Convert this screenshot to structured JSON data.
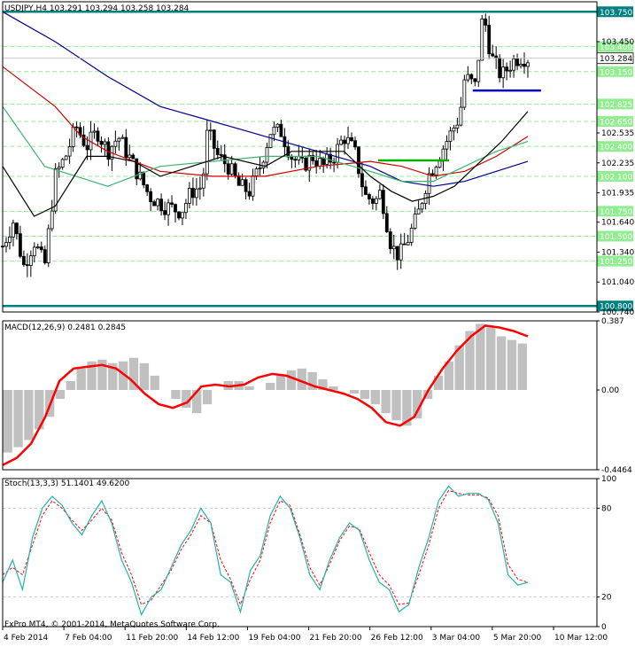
{
  "chart_data": {
    "type": "candlestick",
    "symbol_header": "USDJPY,H4  103.291 103.294 103.258 103.284",
    "current_price": {
      "value": 103.284,
      "label": "103.284"
    },
    "price_axis": {
      "ylim": [
        100.74,
        103.85
      ],
      "ticks": [
        {
          "v": 103.45,
          "t": "103.450"
        },
        {
          "v": 102.535,
          "t": "102.535"
        },
        {
          "v": 102.235,
          "t": "102.235"
        },
        {
          "v": 101.935,
          "t": "101.935"
        },
        {
          "v": 101.64,
          "t": "101.640"
        },
        {
          "v": 101.34,
          "t": "101.340"
        },
        {
          "v": 101.04,
          "t": "101.040"
        },
        {
          "v": 100.74,
          "t": "100.740"
        }
      ]
    },
    "horizontal_levels": [
      {
        "v": 103.75,
        "t": "103.750",
        "color": "#008080",
        "style": "solid"
      },
      {
        "v": 103.4,
        "t": "103.400",
        "color": "#90ee90",
        "style": "dash"
      },
      {
        "v": 103.15,
        "t": "103.150",
        "color": "#90ee90",
        "style": "dash"
      },
      {
        "v": 102.825,
        "t": "102.825",
        "color": "#90ee90",
        "style": "dash"
      },
      {
        "v": 102.65,
        "t": "102.650",
        "color": "#90ee90",
        "style": "dash"
      },
      {
        "v": 102.4,
        "t": "102.400",
        "color": "#90ee90",
        "style": "dash"
      },
      {
        "v": 102.1,
        "t": "102.100",
        "color": "#90ee90",
        "style": "dash"
      },
      {
        "v": 101.75,
        "t": "101.750",
        "color": "#90ee90",
        "style": "dash"
      },
      {
        "v": 101.5,
        "t": "101.500",
        "color": "#90ee90",
        "style": "dash"
      },
      {
        "v": 101.25,
        "t": "101.250",
        "color": "#90ee90",
        "style": "dash"
      },
      {
        "v": 100.8,
        "t": "100.800",
        "color": "#008080",
        "style": "solid"
      }
    ],
    "segments": [
      {
        "name": "green-support",
        "x0": 0.715,
        "x1": 0.85,
        "v": 102.26,
        "color": "#00b000"
      },
      {
        "name": "blue-support",
        "x0": 0.895,
        "x1": 1.025,
        "v": 102.96,
        "color": "#0000cc"
      }
    ],
    "candle_path": [
      [
        0,
        101.4
      ],
      [
        0.02,
        101.65
      ],
      [
        0.04,
        101.2
      ],
      [
        0.06,
        101.45
      ],
      [
        0.08,
        101.2
      ],
      [
        0.1,
        102.1
      ],
      [
        0.12,
        102.3
      ],
      [
        0.14,
        102.6
      ],
      [
        0.16,
        102.4
      ],
      [
        0.18,
        102.55
      ],
      [
        0.2,
        102.35
      ],
      [
        0.22,
        102.5
      ],
      [
        0.24,
        102.3
      ],
      [
        0.28,
        101.9
      ],
      [
        0.31,
        101.8
      ],
      [
        0.34,
        101.75
      ],
      [
        0.36,
        101.95
      ],
      [
        0.38,
        102.0
      ],
      [
        0.39,
        102.55
      ],
      [
        0.41,
        102.3
      ],
      [
        0.43,
        102.2
      ],
      [
        0.45,
        102.0
      ],
      [
        0.47,
        101.95
      ],
      [
        0.49,
        102.2
      ],
      [
        0.51,
        102.55
      ],
      [
        0.53,
        102.55
      ],
      [
        0.55,
        102.3
      ],
      [
        0.57,
        102.2
      ],
      [
        0.59,
        102.3
      ],
      [
        0.61,
        102.2
      ],
      [
        0.63,
        102.3
      ],
      [
        0.65,
        102.5
      ],
      [
        0.67,
        102.35
      ],
      [
        0.69,
        101.9
      ],
      [
        0.71,
        101.85
      ],
      [
        0.72,
        101.95
      ],
      [
        0.74,
        101.4
      ],
      [
        0.755,
        101.3
      ],
      [
        0.77,
        101.45
      ],
      [
        0.79,
        101.7
      ],
      [
        0.81,
        102.1
      ],
      [
        0.83,
        102.3
      ],
      [
        0.85,
        102.5
      ],
      [
        0.87,
        102.7
      ],
      [
        0.88,
        103.1
      ],
      [
        0.9,
        103.0
      ],
      [
        0.915,
        103.75
      ],
      [
        0.93,
        103.3
      ],
      [
        0.95,
        103.1
      ],
      [
        0.97,
        103.25
      ],
      [
        0.985,
        103.3
      ],
      [
        1.0,
        103.284
      ]
    ],
    "moving_averages": [
      {
        "color": "#00008b",
        "points": [
          [
            0,
            103.75
          ],
          [
            0.1,
            103.45
          ],
          [
            0.2,
            103.1
          ],
          [
            0.3,
            102.8
          ],
          [
            0.4,
            102.65
          ],
          [
            0.5,
            102.5
          ],
          [
            0.6,
            102.35
          ],
          [
            0.7,
            102.2
          ],
          [
            0.76,
            102.05
          ],
          [
            0.82,
            102.0
          ],
          [
            0.88,
            102.05
          ],
          [
            0.94,
            102.15
          ],
          [
            1.0,
            102.25
          ]
        ]
      },
      {
        "color": "#cc0000",
        "points": [
          [
            0,
            103.2
          ],
          [
            0.1,
            102.8
          ],
          [
            0.15,
            102.5
          ],
          [
            0.2,
            102.35
          ],
          [
            0.3,
            102.15
          ],
          [
            0.4,
            102.1
          ],
          [
            0.5,
            102.1
          ],
          [
            0.6,
            102.2
          ],
          [
            0.7,
            102.25
          ],
          [
            0.76,
            102.2
          ],
          [
            0.82,
            102.1
          ],
          [
            0.88,
            102.15
          ],
          [
            0.94,
            102.3
          ],
          [
            1.0,
            102.5
          ]
        ]
      },
      {
        "color": "#3cb371",
        "points": [
          [
            0,
            102.8
          ],
          [
            0.08,
            102.2
          ],
          [
            0.14,
            102.1
          ],
          [
            0.2,
            102.0
          ],
          [
            0.25,
            102.1
          ],
          [
            0.3,
            102.2
          ],
          [
            0.4,
            102.25
          ],
          [
            0.5,
            102.3
          ],
          [
            0.6,
            102.3
          ],
          [
            0.7,
            102.15
          ],
          [
            0.76,
            102.05
          ],
          [
            0.82,
            102.05
          ],
          [
            0.88,
            102.2
          ],
          [
            0.94,
            102.35
          ],
          [
            1.0,
            102.45
          ]
        ]
      },
      {
        "color": "#000000",
        "points": [
          [
            0,
            102.2
          ],
          [
            0.06,
            101.7
          ],
          [
            0.1,
            101.8
          ],
          [
            0.16,
            102.3
          ],
          [
            0.2,
            102.3
          ],
          [
            0.25,
            102.25
          ],
          [
            0.3,
            102.1
          ],
          [
            0.36,
            102.2
          ],
          [
            0.42,
            102.3
          ],
          [
            0.5,
            102.2
          ],
          [
            0.55,
            102.35
          ],
          [
            0.6,
            102.35
          ],
          [
            0.65,
            102.35
          ],
          [
            0.7,
            102.1
          ],
          [
            0.74,
            101.95
          ],
          [
            0.78,
            101.85
          ],
          [
            0.82,
            101.9
          ],
          [
            0.86,
            102.0
          ],
          [
            0.9,
            102.2
          ],
          [
            0.95,
            102.45
          ],
          [
            1.0,
            102.75
          ]
        ]
      }
    ],
    "macd": {
      "label": "MACD(12,26,9)  0.2481  0.2845",
      "ylim": [
        -0.4464,
        0.387
      ],
      "ticks": [
        {
          "v": 0.387,
          "t": "0.387"
        },
        {
          "v": 0.0,
          "t": "0.00"
        },
        {
          "v": -0.4464,
          "t": "-0.4464"
        }
      ],
      "histogram_color": "#c0c0c0",
      "signal_color": "#ff0000",
      "histogram": [
        -0.35,
        -0.32,
        -0.28,
        -0.22,
        -0.15,
        -0.05,
        0.05,
        0.12,
        0.16,
        0.17,
        0.15,
        0.16,
        0.18,
        0.15,
        0.08,
        0.0,
        -0.05,
        -0.1,
        -0.13,
        -0.08,
        0.0,
        0.05,
        0.05,
        0.02,
        0.0,
        0.04,
        0.08,
        0.11,
        0.12,
        0.1,
        0.06,
        0.02,
        0.0,
        -0.02,
        -0.05,
        -0.08,
        -0.13,
        -0.17,
        -0.2,
        -0.16,
        -0.05,
        0.08,
        0.16,
        0.25,
        0.33,
        0.37,
        0.35,
        0.3,
        0.28,
        0.26
      ],
      "signal": [
        -0.42,
        -0.38,
        -0.3,
        -0.15,
        0.05,
        0.12,
        0.13,
        0.14,
        0.12,
        0.06,
        -0.02,
        -0.08,
        -0.1,
        -0.07,
        0.02,
        0.03,
        0.02,
        0.03,
        0.07,
        0.09,
        0.08,
        0.05,
        0.02,
        0.0,
        -0.02,
        -0.05,
        -0.1,
        -0.18,
        -0.2,
        -0.15,
        0.0,
        0.12,
        0.22,
        0.3,
        0.36,
        0.35,
        0.33,
        0.3
      ]
    },
    "stochastic": {
      "label": "Stoch(13,3,3)  51.1401  49.6200",
      "ylim": [
        0,
        100
      ],
      "ticks": [
        {
          "v": 100,
          "t": "100"
        },
        {
          "v": 80,
          "t": "80"
        },
        {
          "v": 20,
          "t": "20"
        },
        {
          "v": 0,
          "t": "0"
        }
      ],
      "main_color": "#20b2aa",
      "signal_color": "#ff0000",
      "main": [
        30,
        45,
        25,
        60,
        80,
        88,
        82,
        70,
        62,
        75,
        85,
        70,
        45,
        30,
        8,
        20,
        25,
        40,
        55,
        65,
        80,
        70,
        35,
        30,
        10,
        38,
        48,
        75,
        88,
        80,
        60,
        35,
        25,
        45,
        60,
        70,
        65,
        45,
        30,
        25,
        10,
        15,
        40,
        60,
        85,
        95,
        88,
        90,
        90,
        86,
        70,
        35,
        28,
        30
      ],
      "signal": [
        35,
        40,
        35,
        55,
        75,
        85,
        80,
        72,
        65,
        72,
        80,
        72,
        50,
        35,
        15,
        18,
        28,
        38,
        52,
        62,
        75,
        70,
        45,
        32,
        15,
        32,
        45,
        70,
        85,
        82,
        62,
        40,
        28,
        42,
        58,
        68,
        66,
        50,
        35,
        28,
        15,
        16,
        35,
        55,
        80,
        92,
        90,
        89,
        89,
        87,
        75,
        42,
        32,
        30
      ]
    },
    "time_labels": [
      "4 Feb 2014",
      "7 Feb 04:00",
      "11 Feb 20:00",
      "14 Feb 12:00",
      "19 Feb 04:00",
      "21 Feb 20:00",
      "26 Feb 12:00",
      "3 Mar 04:00",
      "5 Mar 20:00",
      "10 Mar 12:00"
    ],
    "copyright": "FxPro MT4, © 2001-2014, MetaQuotes Software Corp."
  }
}
